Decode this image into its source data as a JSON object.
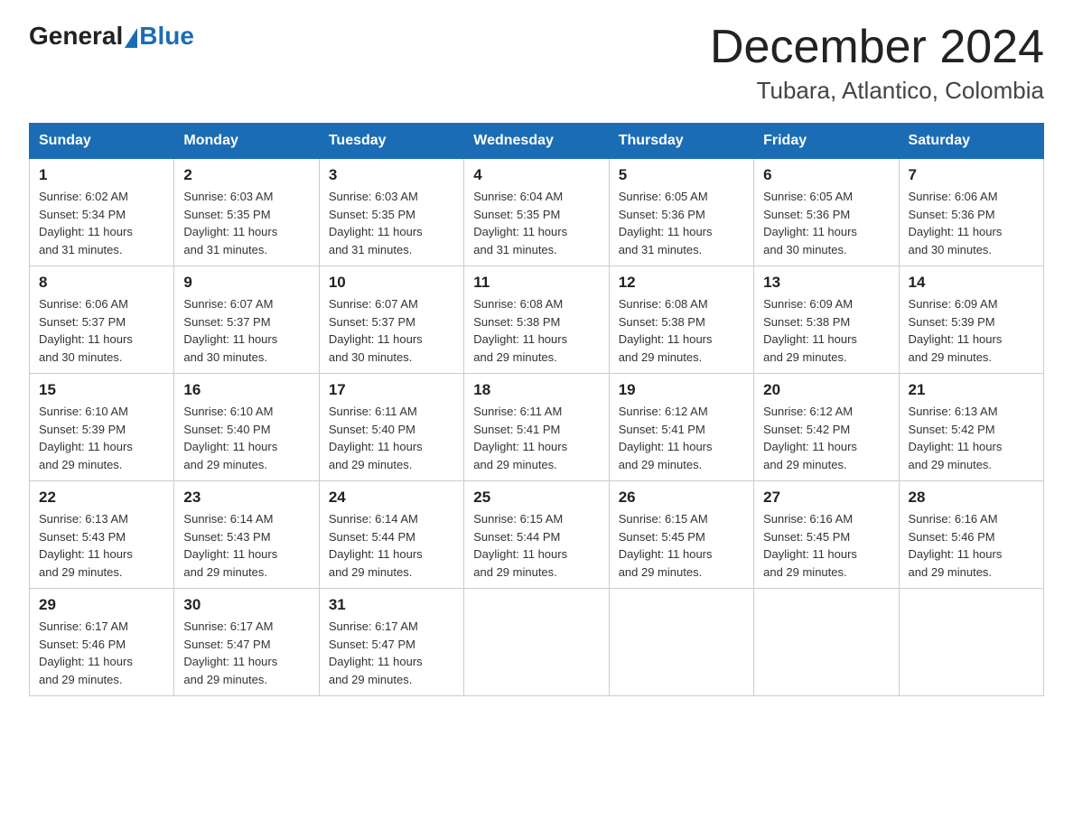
{
  "logo": {
    "general": "General",
    "blue": "Blue"
  },
  "title": "December 2024",
  "subtitle": "Tubara, Atlantico, Colombia",
  "days_of_week": [
    "Sunday",
    "Monday",
    "Tuesday",
    "Wednesday",
    "Thursday",
    "Friday",
    "Saturday"
  ],
  "weeks": [
    [
      {
        "day": "1",
        "sunrise": "6:02 AM",
        "sunset": "5:34 PM",
        "daylight": "11 hours and 31 minutes."
      },
      {
        "day": "2",
        "sunrise": "6:03 AM",
        "sunset": "5:35 PM",
        "daylight": "11 hours and 31 minutes."
      },
      {
        "day": "3",
        "sunrise": "6:03 AM",
        "sunset": "5:35 PM",
        "daylight": "11 hours and 31 minutes."
      },
      {
        "day": "4",
        "sunrise": "6:04 AM",
        "sunset": "5:35 PM",
        "daylight": "11 hours and 31 minutes."
      },
      {
        "day": "5",
        "sunrise": "6:05 AM",
        "sunset": "5:36 PM",
        "daylight": "11 hours and 31 minutes."
      },
      {
        "day": "6",
        "sunrise": "6:05 AM",
        "sunset": "5:36 PM",
        "daylight": "11 hours and 30 minutes."
      },
      {
        "day": "7",
        "sunrise": "6:06 AM",
        "sunset": "5:36 PM",
        "daylight": "11 hours and 30 minutes."
      }
    ],
    [
      {
        "day": "8",
        "sunrise": "6:06 AM",
        "sunset": "5:37 PM",
        "daylight": "11 hours and 30 minutes."
      },
      {
        "day": "9",
        "sunrise": "6:07 AM",
        "sunset": "5:37 PM",
        "daylight": "11 hours and 30 minutes."
      },
      {
        "day": "10",
        "sunrise": "6:07 AM",
        "sunset": "5:37 PM",
        "daylight": "11 hours and 30 minutes."
      },
      {
        "day": "11",
        "sunrise": "6:08 AM",
        "sunset": "5:38 PM",
        "daylight": "11 hours and 29 minutes."
      },
      {
        "day": "12",
        "sunrise": "6:08 AM",
        "sunset": "5:38 PM",
        "daylight": "11 hours and 29 minutes."
      },
      {
        "day": "13",
        "sunrise": "6:09 AM",
        "sunset": "5:38 PM",
        "daylight": "11 hours and 29 minutes."
      },
      {
        "day": "14",
        "sunrise": "6:09 AM",
        "sunset": "5:39 PM",
        "daylight": "11 hours and 29 minutes."
      }
    ],
    [
      {
        "day": "15",
        "sunrise": "6:10 AM",
        "sunset": "5:39 PM",
        "daylight": "11 hours and 29 minutes."
      },
      {
        "day": "16",
        "sunrise": "6:10 AM",
        "sunset": "5:40 PM",
        "daylight": "11 hours and 29 minutes."
      },
      {
        "day": "17",
        "sunrise": "6:11 AM",
        "sunset": "5:40 PM",
        "daylight": "11 hours and 29 minutes."
      },
      {
        "day": "18",
        "sunrise": "6:11 AM",
        "sunset": "5:41 PM",
        "daylight": "11 hours and 29 minutes."
      },
      {
        "day": "19",
        "sunrise": "6:12 AM",
        "sunset": "5:41 PM",
        "daylight": "11 hours and 29 minutes."
      },
      {
        "day": "20",
        "sunrise": "6:12 AM",
        "sunset": "5:42 PM",
        "daylight": "11 hours and 29 minutes."
      },
      {
        "day": "21",
        "sunrise": "6:13 AM",
        "sunset": "5:42 PM",
        "daylight": "11 hours and 29 minutes."
      }
    ],
    [
      {
        "day": "22",
        "sunrise": "6:13 AM",
        "sunset": "5:43 PM",
        "daylight": "11 hours and 29 minutes."
      },
      {
        "day": "23",
        "sunrise": "6:14 AM",
        "sunset": "5:43 PM",
        "daylight": "11 hours and 29 minutes."
      },
      {
        "day": "24",
        "sunrise": "6:14 AM",
        "sunset": "5:44 PM",
        "daylight": "11 hours and 29 minutes."
      },
      {
        "day": "25",
        "sunrise": "6:15 AM",
        "sunset": "5:44 PM",
        "daylight": "11 hours and 29 minutes."
      },
      {
        "day": "26",
        "sunrise": "6:15 AM",
        "sunset": "5:45 PM",
        "daylight": "11 hours and 29 minutes."
      },
      {
        "day": "27",
        "sunrise": "6:16 AM",
        "sunset": "5:45 PM",
        "daylight": "11 hours and 29 minutes."
      },
      {
        "day": "28",
        "sunrise": "6:16 AM",
        "sunset": "5:46 PM",
        "daylight": "11 hours and 29 minutes."
      }
    ],
    [
      {
        "day": "29",
        "sunrise": "6:17 AM",
        "sunset": "5:46 PM",
        "daylight": "11 hours and 29 minutes."
      },
      {
        "day": "30",
        "sunrise": "6:17 AM",
        "sunset": "5:47 PM",
        "daylight": "11 hours and 29 minutes."
      },
      {
        "day": "31",
        "sunrise": "6:17 AM",
        "sunset": "5:47 PM",
        "daylight": "11 hours and 29 minutes."
      },
      null,
      null,
      null,
      null
    ]
  ],
  "labels": {
    "sunrise": "Sunrise:",
    "sunset": "Sunset:",
    "daylight": "Daylight:"
  }
}
